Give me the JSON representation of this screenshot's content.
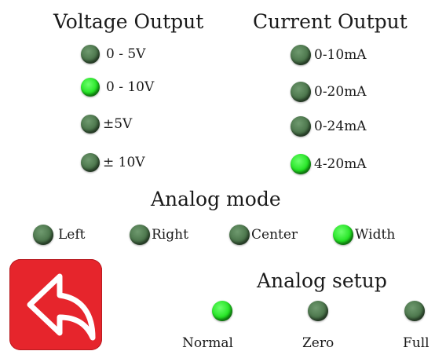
{
  "voltage_output": {
    "title": "Voltage Output",
    "options": [
      {
        "label": "0 - 5V",
        "active": false
      },
      {
        "label": "0 - 10V",
        "active": true
      },
      {
        "label": "±5V",
        "active": false
      },
      {
        "label": "± 10V",
        "active": false
      }
    ]
  },
  "current_output": {
    "title": "Current Output",
    "options": [
      {
        "label": "0-10mA",
        "active": false
      },
      {
        "label": "0-20mA",
        "active": false
      },
      {
        "label": "0-24mA",
        "active": false
      },
      {
        "label": "4-20mA",
        "active": true
      }
    ]
  },
  "analog_mode": {
    "title": "Analog mode",
    "options": [
      {
        "label": "Left",
        "active": false
      },
      {
        "label": "Right",
        "active": false
      },
      {
        "label": "Center",
        "active": false
      },
      {
        "label": "Width",
        "active": true
      }
    ]
  },
  "analog_setup": {
    "title": "Analog setup",
    "options": [
      {
        "label": "Normal",
        "active": true
      },
      {
        "label": "Zero",
        "active": false
      },
      {
        "label": "Full",
        "active": false
      }
    ]
  },
  "back_button": {
    "icon": "back-arrow-icon",
    "color": "#e6252c"
  },
  "colors": {
    "led_on": "#22e322",
    "led_off": "#4a744a"
  }
}
